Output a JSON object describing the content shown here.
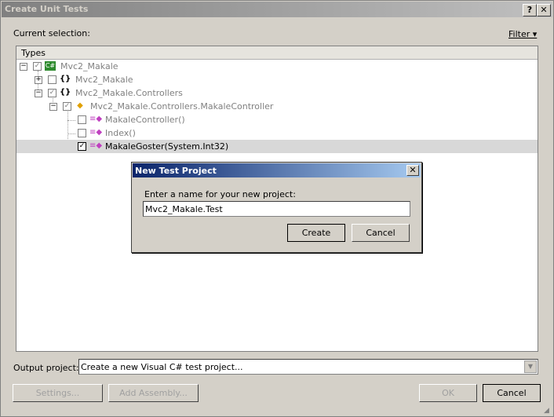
{
  "window": {
    "title": "Create Unit Tests",
    "help_glyph": "?",
    "close_glyph": "✕"
  },
  "current_selection_label": "Current selection:",
  "filter_label": "Filter ▾",
  "tree": {
    "header": "Types",
    "rows": [
      {
        "label": "Mvc2_Makale",
        "icon": "csharp-project-icon",
        "checked": "partial",
        "expander": "−"
      },
      {
        "label": "Mvc2_Makale",
        "icon": "namespace-icon",
        "checked": false,
        "expander": "+"
      },
      {
        "label": "Mvc2_Makale.Controllers",
        "icon": "namespace-icon",
        "checked": "partial",
        "expander": "−"
      },
      {
        "label": "Mvc2_Makale.Controllers.MakaleController",
        "icon": "class-icon",
        "checked": "partial",
        "expander": "−"
      },
      {
        "label": "MakaleController()",
        "icon": "method-icon",
        "checked": false
      },
      {
        "label": "Index()",
        "icon": "method-icon",
        "checked": false
      },
      {
        "label": "MakaleGoster(System.Int32)",
        "icon": "method-icon",
        "checked": true
      }
    ]
  },
  "output_project": {
    "label": "Output project:",
    "value": "Create a new Visual C# test project..."
  },
  "buttons": {
    "settings": "Settings...",
    "add_assembly": "Add Assembly...",
    "ok": "OK",
    "cancel": "Cancel"
  },
  "dialog": {
    "title": "New Test Project",
    "prompt": "Enter a name for your new project:",
    "input_value": "Mvc2_Makale.Test",
    "create": "Create",
    "cancel": "Cancel"
  }
}
